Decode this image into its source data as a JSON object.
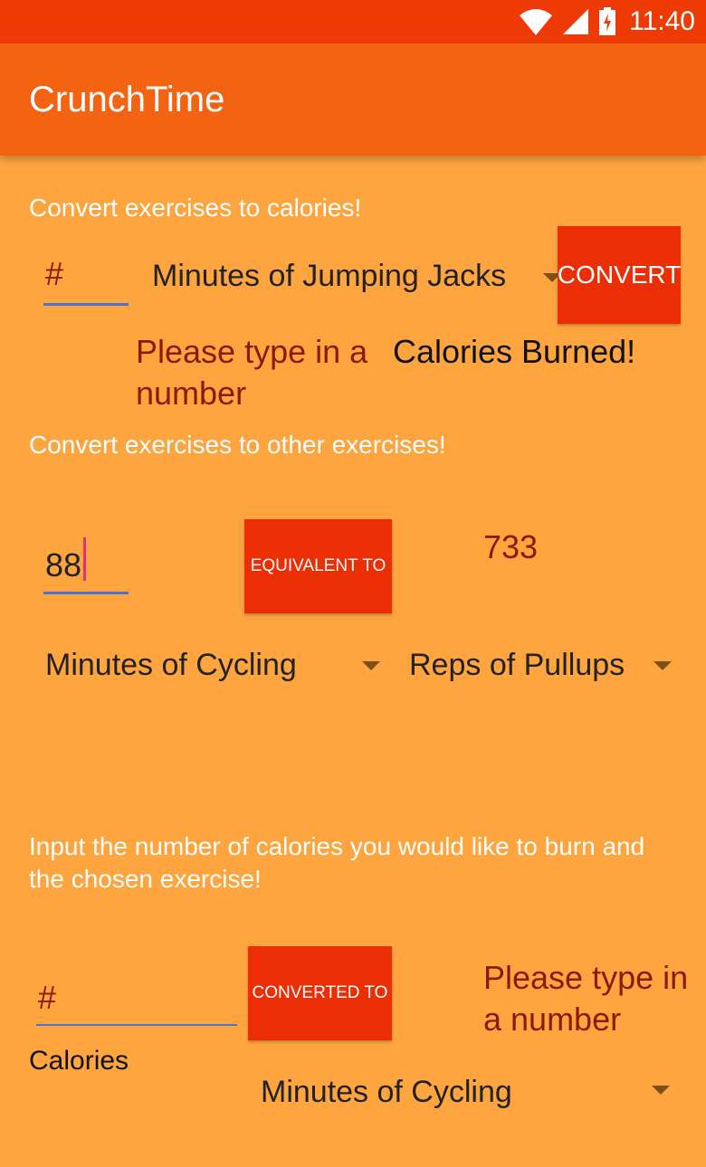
{
  "status_bar": {
    "time": "11:40"
  },
  "app": {
    "title": "CrunchTime"
  },
  "section1": {
    "heading": "Convert exercises to calories!",
    "number_input": {
      "value": "",
      "placeholder": "#"
    },
    "exercise_spinner": {
      "selected": "Minutes of Jumping Jacks"
    },
    "convert_label": "CONVERT",
    "error_text": "Please type in a number",
    "result_label": "Calories Burned!"
  },
  "section2": {
    "heading": "Convert exercises to other exercises!",
    "number_input": {
      "value": "88"
    },
    "equivalent_label": "EQUIVALENT TO",
    "result_value": "733",
    "from_spinner": {
      "selected": "Minutes of Cycling"
    },
    "to_spinner": {
      "selected": "Reps of Pullups"
    }
  },
  "section3": {
    "heading": "Input the number of calories you would like to burn and the chosen exercise!",
    "calories_input": {
      "value": "",
      "placeholder": "#"
    },
    "converted_label": "CONVERTED TO",
    "error_text": "Please type in a number",
    "calories_label": "Calories",
    "exercise_spinner": {
      "selected": "Minutes of Cycling"
    }
  }
}
